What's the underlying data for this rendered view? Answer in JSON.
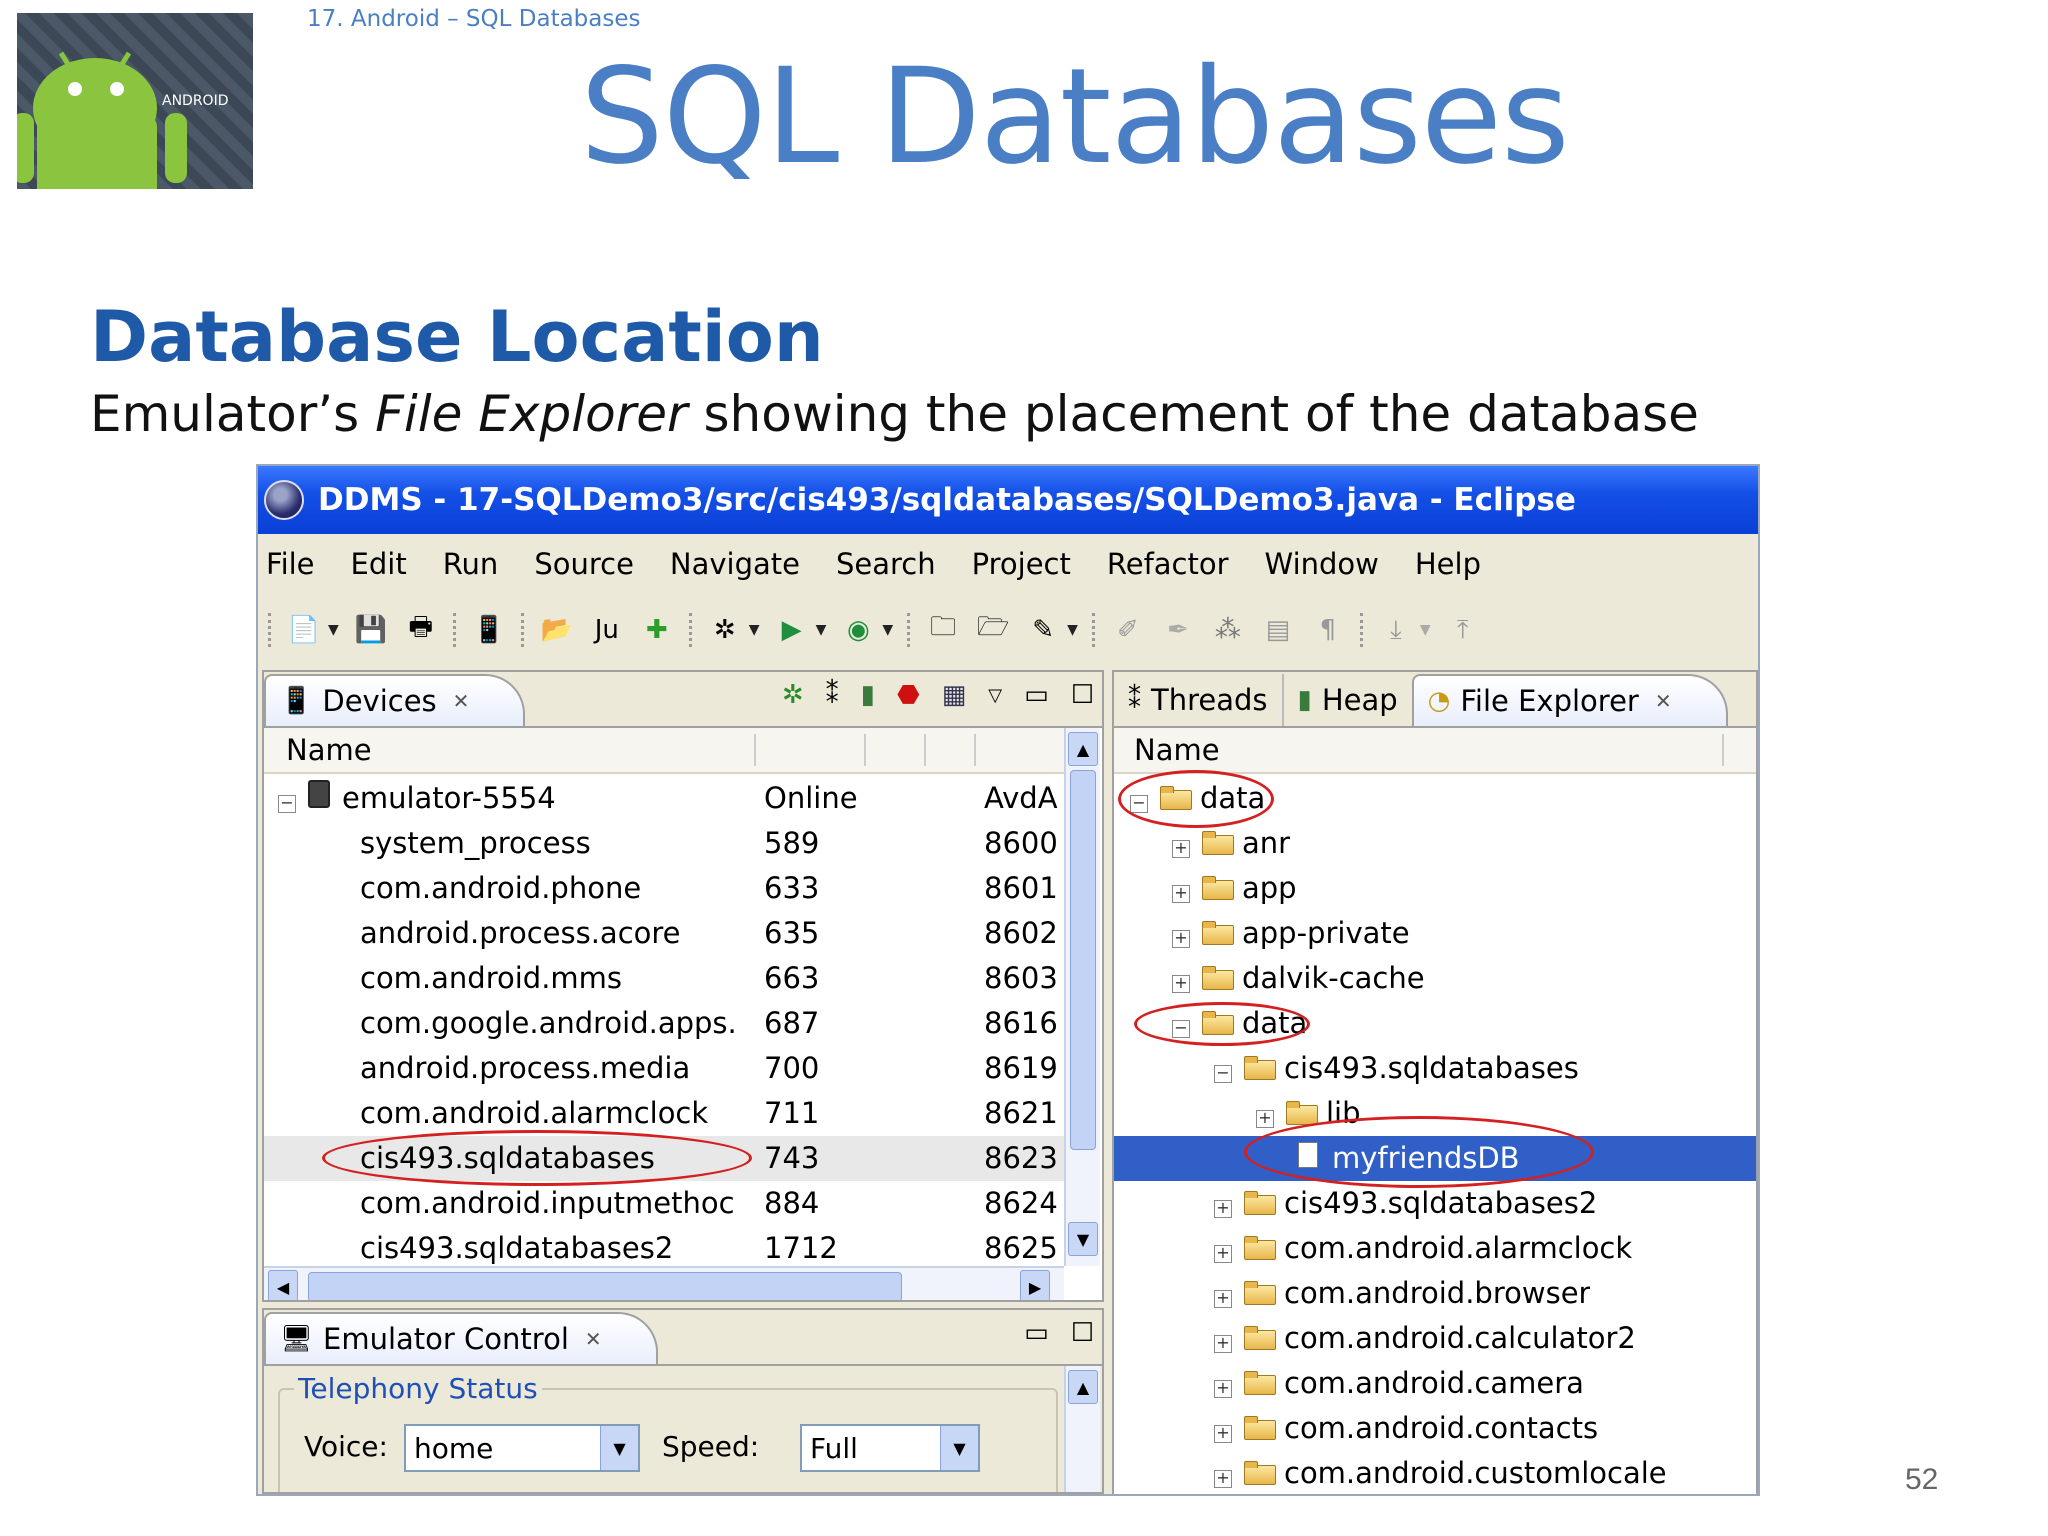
{
  "slide": {
    "breadcrumb": "17. Android – SQL Databases",
    "title": "SQL Databases",
    "section_title": "Database Location",
    "caption_prefix": "Emulator’s ",
    "caption_italic": "File Explorer",
    "caption_suffix": " showing the placement of the database",
    "page_number": "52",
    "logo_text": "ANDROID"
  },
  "window": {
    "title": "DDMS - 17-SQLDemo3/src/cis493/sqldatabases/SQLDemo3.java - Eclipse",
    "menu": [
      "File",
      "Edit",
      "Run",
      "Source",
      "Navigate",
      "Search",
      "Project",
      "Refactor",
      "Window",
      "Help"
    ]
  },
  "devices": {
    "tab_label": "Devices",
    "column_name": "Name",
    "rows": [
      {
        "name": "emulator-5554",
        "col2": "Online",
        "col3": "AvdA"
      },
      {
        "name": "system_process",
        "col2": "589",
        "col3": "8600"
      },
      {
        "name": "com.android.phone",
        "col2": "633",
        "col3": "8601"
      },
      {
        "name": "android.process.acore",
        "col2": "635",
        "col3": "8602"
      },
      {
        "name": "com.android.mms",
        "col2": "663",
        "col3": "8603"
      },
      {
        "name": "com.google.android.apps.",
        "col2": "687",
        "col3": "8616"
      },
      {
        "name": "android.process.media",
        "col2": "700",
        "col3": "8619"
      },
      {
        "name": "com.android.alarmclock",
        "col2": "711",
        "col3": "8621"
      },
      {
        "name": "cis493.sqldatabases",
        "col2": "743",
        "col3": "8623"
      },
      {
        "name": "com.android.inputmethoc",
        "col2": "884",
        "col3": "8624"
      },
      {
        "name": "cis493.sqldatabases2",
        "col2": "1712",
        "col3": "8625"
      }
    ]
  },
  "file_explorer": {
    "tabs": [
      "Threads",
      "Heap",
      "File Explorer"
    ],
    "column_name": "Name",
    "items": [
      {
        "label": "data",
        "expanded": true
      },
      {
        "label": "anr",
        "expanded": false
      },
      {
        "label": "app",
        "expanded": false
      },
      {
        "label": "app-private",
        "expanded": false
      },
      {
        "label": "dalvik-cache",
        "expanded": false
      },
      {
        "label": "data",
        "expanded": true
      },
      {
        "label": "cis493.sqldatabases",
        "expanded": true
      },
      {
        "label": "lib",
        "expanded": false
      },
      {
        "label": "myfriendsDB",
        "expanded": null
      },
      {
        "label": "cis493.sqldatabases2",
        "expanded": false
      },
      {
        "label": "com.android.alarmclock",
        "expanded": false
      },
      {
        "label": "com.android.browser",
        "expanded": false
      },
      {
        "label": "com.android.calculator2",
        "expanded": false
      },
      {
        "label": "com.android.camera",
        "expanded": false
      },
      {
        "label": "com.android.contacts",
        "expanded": false
      },
      {
        "label": "com.android.customlocale",
        "expanded": false
      }
    ]
  },
  "emulator_control": {
    "tab_label": "Emulator Control",
    "group_label": "Telephony Status",
    "voice_label": "Voice:",
    "voice_value": "home",
    "speed_label": "Speed:",
    "speed_value": "Full"
  },
  "colors": {
    "accent_blue": "#4a7fc5",
    "section_blue": "#1f5aa8",
    "selection_blue": "#2f5fc7",
    "highlight_circle": "#d42020"
  }
}
